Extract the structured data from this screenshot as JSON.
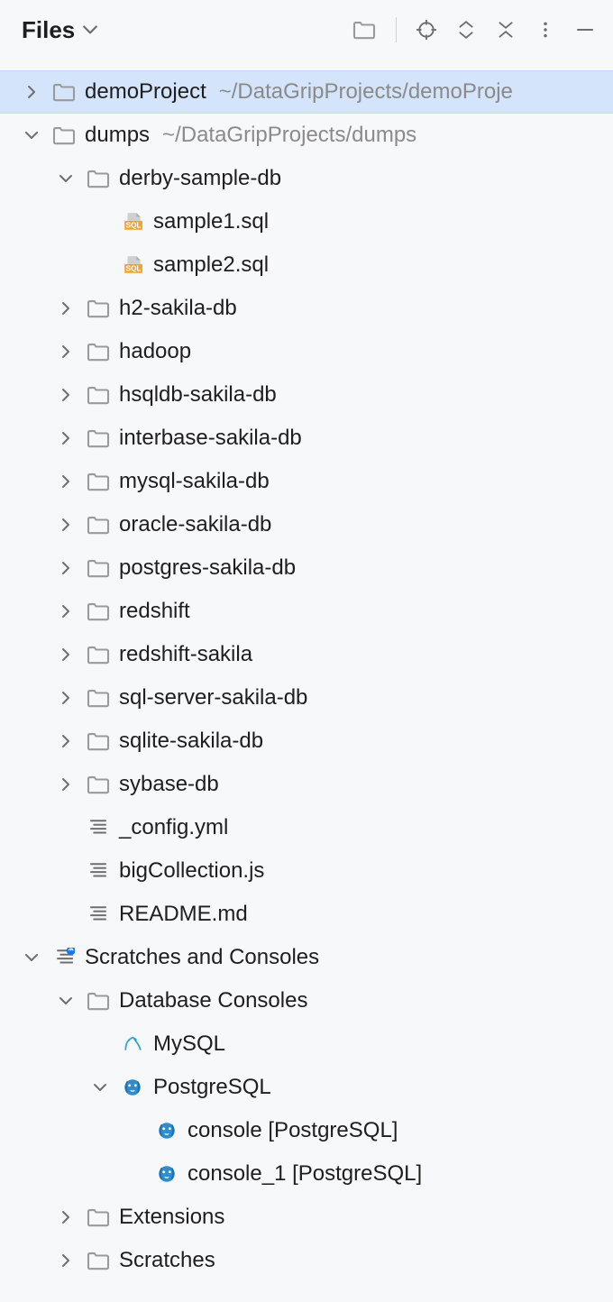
{
  "header": {
    "title": "Files"
  },
  "tree": [
    {
      "indent": 0,
      "arrow": "right",
      "icon": "folder",
      "label": "demoProject",
      "path": "~/DataGripProjects/demoProje",
      "selected": true
    },
    {
      "indent": 0,
      "arrow": "down",
      "icon": "folder",
      "label": "dumps",
      "path": "~/DataGripProjects/dumps",
      "selected": false
    },
    {
      "indent": 1,
      "arrow": "down",
      "icon": "folder",
      "label": "derby-sample-db",
      "selected": false
    },
    {
      "indent": 2,
      "arrow": "none",
      "icon": "sql",
      "label": "sample1.sql",
      "selected": false
    },
    {
      "indent": 2,
      "arrow": "none",
      "icon": "sql",
      "label": "sample2.sql",
      "selected": false
    },
    {
      "indent": 1,
      "arrow": "right",
      "icon": "folder",
      "label": "h2-sakila-db",
      "selected": false
    },
    {
      "indent": 1,
      "arrow": "right",
      "icon": "folder",
      "label": "hadoop",
      "selected": false
    },
    {
      "indent": 1,
      "arrow": "right",
      "icon": "folder",
      "label": "hsqldb-sakila-db",
      "selected": false
    },
    {
      "indent": 1,
      "arrow": "right",
      "icon": "folder",
      "label": "interbase-sakila-db",
      "selected": false
    },
    {
      "indent": 1,
      "arrow": "right",
      "icon": "folder",
      "label": "mysql-sakila-db",
      "selected": false
    },
    {
      "indent": 1,
      "arrow": "right",
      "icon": "folder",
      "label": "oracle-sakila-db",
      "selected": false
    },
    {
      "indent": 1,
      "arrow": "right",
      "icon": "folder",
      "label": "postgres-sakila-db",
      "selected": false
    },
    {
      "indent": 1,
      "arrow": "right",
      "icon": "folder",
      "label": "redshift",
      "selected": false
    },
    {
      "indent": 1,
      "arrow": "right",
      "icon": "folder",
      "label": "redshift-sakila",
      "selected": false
    },
    {
      "indent": 1,
      "arrow": "right",
      "icon": "folder",
      "label": "sql-server-sakila-db",
      "selected": false
    },
    {
      "indent": 1,
      "arrow": "right",
      "icon": "folder",
      "label": "sqlite-sakila-db",
      "selected": false
    },
    {
      "indent": 1,
      "arrow": "right",
      "icon": "folder",
      "label": "sybase-db",
      "selected": false
    },
    {
      "indent": 1,
      "arrow": "none",
      "icon": "textfile",
      "label": "_config.yml",
      "selected": false
    },
    {
      "indent": 1,
      "arrow": "none",
      "icon": "textfile",
      "label": "bigCollection.js",
      "selected": false
    },
    {
      "indent": 1,
      "arrow": "none",
      "icon": "textfile",
      "label": "README.md",
      "selected": false
    },
    {
      "indent": 0,
      "arrow": "down",
      "icon": "scratches",
      "label": "Scratches and Consoles",
      "selected": false
    },
    {
      "indent": 1,
      "arrow": "down",
      "icon": "folder",
      "label": "Database Consoles",
      "selected": false
    },
    {
      "indent": 2,
      "arrow": "none",
      "icon": "mysql",
      "label": "MySQL",
      "selected": false
    },
    {
      "indent": 2,
      "arrow": "down",
      "icon": "postgres",
      "label": "PostgreSQL",
      "selected": false
    },
    {
      "indent": 3,
      "arrow": "none",
      "icon": "postgres",
      "label": "console [PostgreSQL]",
      "selected": false
    },
    {
      "indent": 3,
      "arrow": "none",
      "icon": "postgres",
      "label": "console_1 [PostgreSQL]",
      "selected": false
    },
    {
      "indent": 1,
      "arrow": "right",
      "icon": "folder",
      "label": "Extensions",
      "selected": false
    },
    {
      "indent": 1,
      "arrow": "right",
      "icon": "folder",
      "label": "Scratches",
      "selected": false
    }
  ]
}
